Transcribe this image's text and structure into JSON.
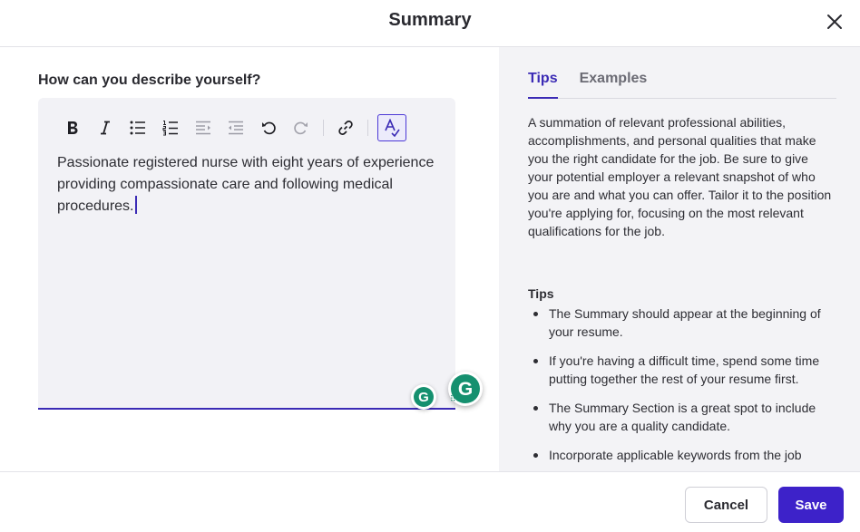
{
  "dialog": {
    "title": "Summary",
    "close_icon": "close-icon"
  },
  "editor": {
    "question": "How can you describe yourself?",
    "content": "Passionate registered nurse with eight years of experience providing compassionate care and following medical procedures.",
    "toolbar": [
      "bold-icon",
      "italic-icon",
      "bullet-list-icon",
      "numbered-list-icon",
      "indent-icon",
      "outdent-icon",
      "undo-icon",
      "redo-icon",
      "link-icon",
      "spellcheck-icon"
    ],
    "accent_color": "#3b2bb5"
  },
  "grammarly": {
    "icon": "grammarly-icon",
    "letter": "G",
    "color": "#15906f"
  },
  "side_panel": {
    "tabs": [
      {
        "label": "Tips",
        "active": true
      },
      {
        "label": "Examples",
        "active": false
      }
    ],
    "description": "A summation of relevant professional abilities, accomplishments, and personal qualities that make you the right candidate for the job. Be sure to give your potential employer a relevant snapshot of who you are and what you can offer. Tailor it to the position you're applying for, focusing on the most relevant qualifications for the job.",
    "tips_heading": "Tips",
    "tips": [
      "The Summary should appear at the beginning of your resume.",
      "If you're having a difficult time, spend some time putting together the rest of your resume first.",
      "The Summary Section is a great spot to include why you are a quality candidate.",
      "Incorporate applicable keywords from the job"
    ]
  },
  "footer": {
    "cancel_label": "Cancel",
    "save_label": "Save",
    "save_color": "#3d22c9"
  }
}
